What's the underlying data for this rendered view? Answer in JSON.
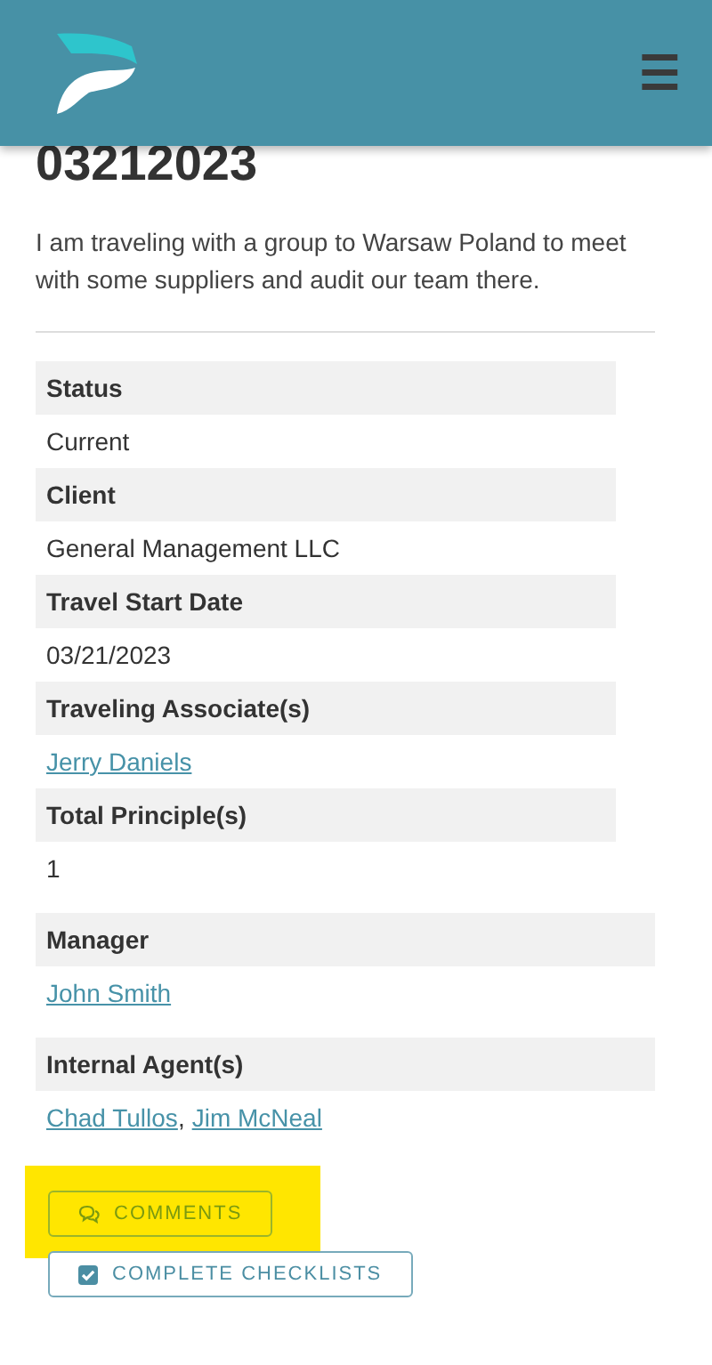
{
  "header": {
    "menu_icon": "☰"
  },
  "title": "03212023",
  "description": "I am traveling with a group to Warsaw Poland to meet with some suppliers and audit our team there.",
  "fields": [
    {
      "label": "Status",
      "kind": "text",
      "value": "Current"
    },
    {
      "label": "Client",
      "kind": "text",
      "value": "General Management LLC"
    },
    {
      "label": "Travel Start Date",
      "kind": "text",
      "value": "03/21/2023"
    },
    {
      "label": "Traveling Associate(s)",
      "kind": "links",
      "links": [
        "Jerry Daniels"
      ]
    },
    {
      "label": "Total Principle(s)",
      "kind": "text",
      "value": "1"
    },
    {
      "label": "Manager",
      "kind": "links",
      "links": [
        "John Smith"
      ]
    },
    {
      "label": "Internal Agent(s)",
      "kind": "links",
      "links": [
        "Chad Tullos",
        "Jim McNeal"
      ],
      "separator": ","
    }
  ],
  "buttons": [
    {
      "label": "COMMENTS",
      "kind": "comments",
      "highlighted": true
    },
    {
      "label": "COMPLETE CHECKLISTS",
      "kind": "checklist",
      "highlighted": false
    }
  ]
}
